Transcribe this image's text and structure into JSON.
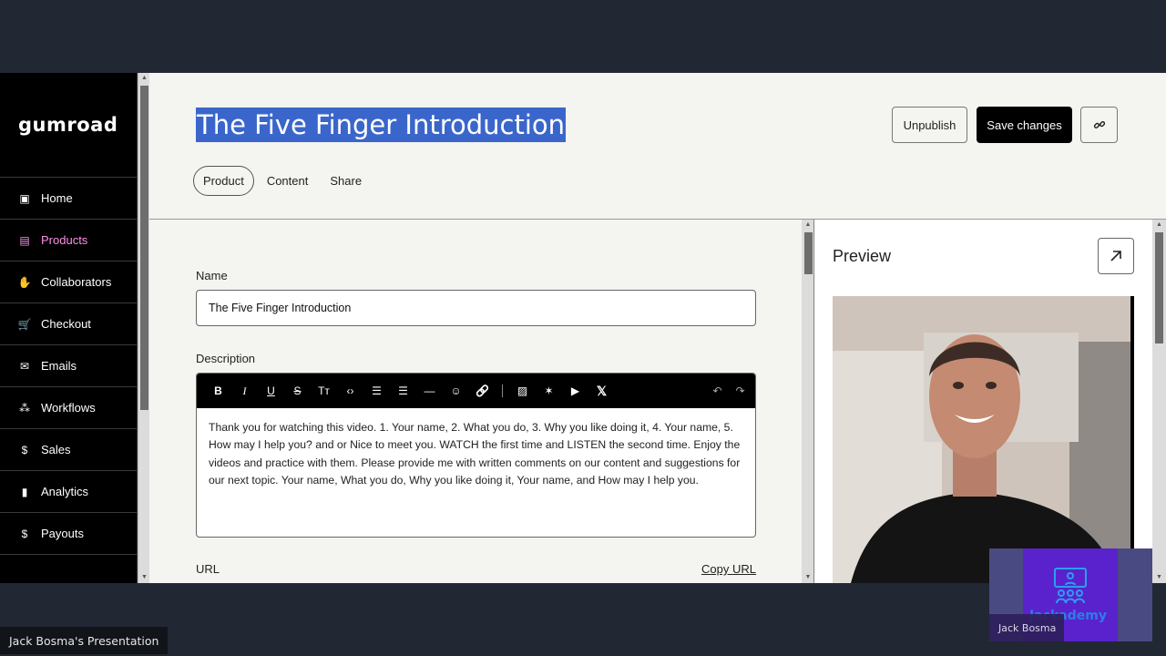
{
  "app": {
    "brand": "gumroad",
    "colors": {
      "accent": "#ff90e8",
      "selection": "#3a66cc",
      "sidebar_bg": "#000000",
      "page_bg": "#f4f4f0"
    }
  },
  "sidebar": {
    "items": [
      {
        "label": "Home",
        "icon": "store-icon",
        "glyph": "▣",
        "active": false
      },
      {
        "label": "Products",
        "icon": "archive-icon",
        "glyph": "▤",
        "active": true
      },
      {
        "label": "Collaborators",
        "icon": "handshake-icon",
        "glyph": "✋",
        "active": false
      },
      {
        "label": "Checkout",
        "icon": "cart-icon",
        "glyph": "🛒",
        "active": false
      },
      {
        "label": "Emails",
        "icon": "envelope-icon",
        "glyph": "✉",
        "active": false
      },
      {
        "label": "Workflows",
        "icon": "workflow-icon",
        "glyph": "⁂",
        "active": false
      },
      {
        "label": "Sales",
        "icon": "dollar-circle-icon",
        "glyph": "$",
        "active": false
      },
      {
        "label": "Analytics",
        "icon": "bar-chart-icon",
        "glyph": "▮",
        "active": false
      },
      {
        "label": "Payouts",
        "icon": "dollar-circle-icon",
        "glyph": "$",
        "active": false
      }
    ]
  },
  "header": {
    "title": "The Five Finger Introduction",
    "unpublish_label": "Unpublish",
    "save_label": "Save changes",
    "tabs": [
      {
        "label": "Product",
        "active": true
      },
      {
        "label": "Content",
        "active": false
      },
      {
        "label": "Share",
        "active": false
      }
    ]
  },
  "form": {
    "name_label": "Name",
    "name_value": "The Five Finger Introduction",
    "description_label": "Description",
    "toolbar": {
      "bold": "B",
      "italic": "I",
      "underline": "U",
      "strike": "S",
      "text_size": "Tт",
      "code": "‹›",
      "bullet_list": "☰",
      "numbered_list": "☰",
      "divider": "—",
      "comment": "☺",
      "link": "🔗",
      "image": "▨",
      "embed": "✶",
      "video": "▶",
      "twitter": "𝕏",
      "undo": "↶",
      "redo": "↷"
    },
    "description_value": "Thank you for watching this video. 1. Your name, 2. What you do, 3. Why you like doing it, 4. Your name, 5. How may I help you? and or Nice to meet you. WATCH the first time and LISTEN the second time. Enjoy the videos and practice with them. Please provide me with written comments on our content and suggestions for our next topic. Your name, What you do, Why you like doing it, Your name, and How may I help you.",
    "url_label": "URL",
    "copy_url_label": "Copy URL"
  },
  "preview": {
    "title": "Preview"
  },
  "meeting": {
    "presentation_label": "Jack Bosma's Presentation",
    "participant_name": "Jack Bosma",
    "participant_brand": "Jackademy"
  }
}
